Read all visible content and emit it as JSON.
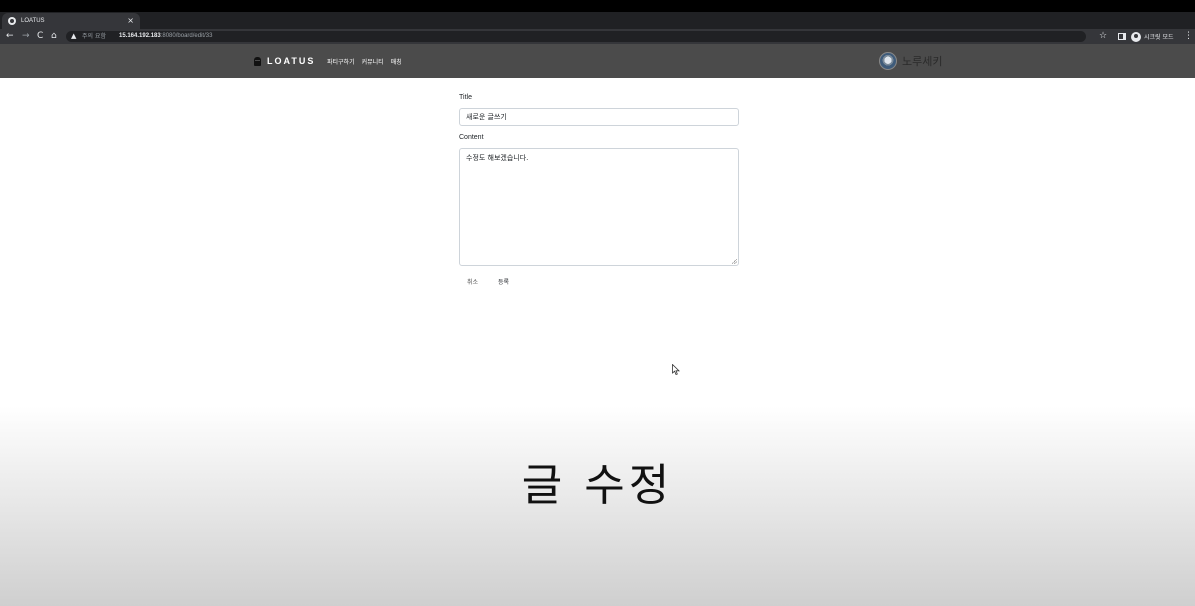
{
  "browser": {
    "tab_title": "LOATUS",
    "tab_close": "×",
    "new_tab": "+",
    "window_controls": [
      "⌄",
      "−",
      "▫",
      "✕"
    ],
    "security_label": "주의 요함",
    "url_host": "15.164.192.183",
    "url_path": ":8080/board/edit/33",
    "profile_label": "시크릿 모드",
    "icons": [
      "back-icon",
      "forward-icon",
      "reload-icon",
      "home-icon",
      "warning-icon",
      "star-icon",
      "side-panel-icon",
      "menu-icon"
    ]
  },
  "site": {
    "brand": "LOATUS",
    "nav": [
      "파티구하기",
      "커뮤니티",
      "매칭"
    ],
    "user_name": "노루세키"
  },
  "form": {
    "title_label": "Title",
    "title_value": "새로운 글쓰기",
    "content_label": "Content",
    "content_value": "수정도 해보겠습니다.",
    "cancel_label": "취소",
    "submit_label": "등록"
  },
  "caption": "글 수정",
  "colors": {
    "nav_bg": "#4b4b4b",
    "tab_bg": "#35363a",
    "chrome_bg": "#202124",
    "input_border": "#ced4da"
  }
}
